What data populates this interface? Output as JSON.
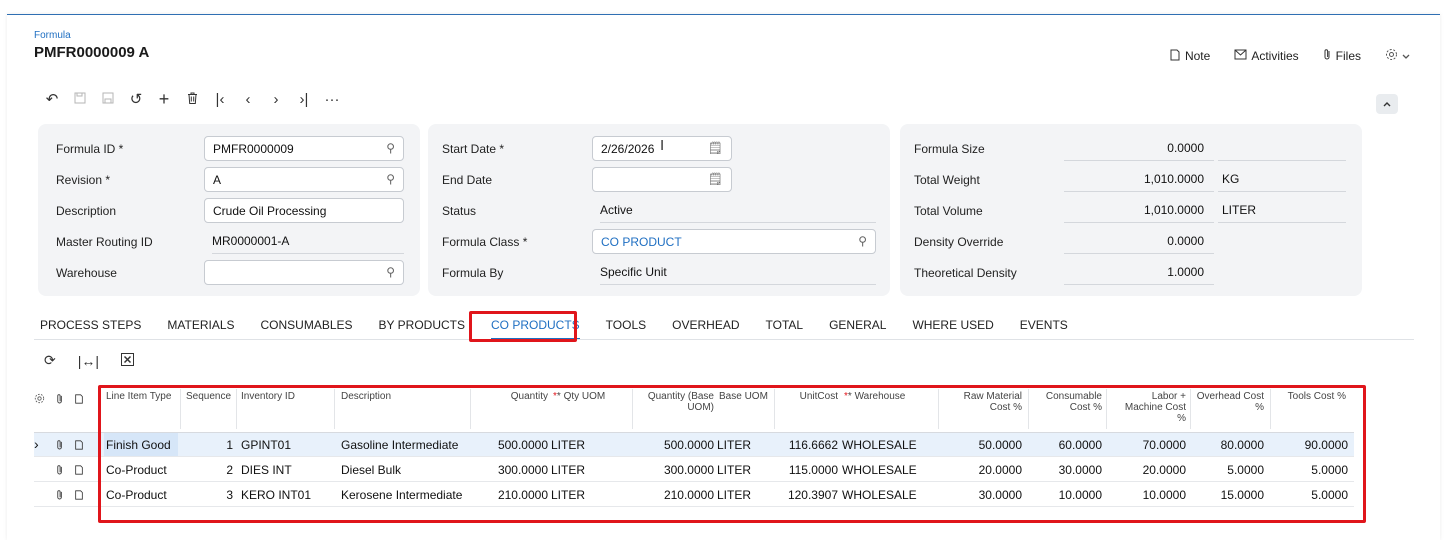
{
  "header": {
    "breadcrumb": "Formula",
    "title": "PMFR0000009 A",
    "actions": {
      "note": "Note",
      "activities": "Activities",
      "files": "Files"
    }
  },
  "toolbar": {
    "icons": [
      "back-icon",
      "save-icon",
      "save-close-icon",
      "cancel-icon",
      "add-icon",
      "delete-icon",
      "first-icon",
      "previous-icon",
      "next-icon",
      "last-icon",
      "more-icon"
    ]
  },
  "summary": {
    "col1": {
      "formula_id": {
        "label": "Formula ID",
        "value": "PMFR0000009"
      },
      "revision": {
        "label": "Revision",
        "value": "A"
      },
      "description": {
        "label": "Description",
        "value": "Crude Oil Processing"
      },
      "master_routing": {
        "label": "Master Routing ID",
        "value": "MR0000001-A"
      },
      "warehouse": {
        "label": "Warehouse",
        "value": ""
      }
    },
    "col2": {
      "start_date": {
        "label": "Start Date",
        "value": "2/26/2026"
      },
      "end_date": {
        "label": "End Date",
        "value": ""
      },
      "status": {
        "label": "Status",
        "value": "Active"
      },
      "formula_class": {
        "label": "Formula Class",
        "value": "CO PRODUCT"
      },
      "formula_by": {
        "label": "Formula By",
        "value": "Specific Unit"
      }
    },
    "col3": {
      "formula_size": {
        "label": "Formula Size",
        "value": "0.0000",
        "unit": ""
      },
      "total_weight": {
        "label": "Total Weight",
        "value": "1,010.0000",
        "unit": "KG"
      },
      "total_volume": {
        "label": "Total Volume",
        "value": "1,010.0000",
        "unit": "LITER"
      },
      "density_override": {
        "label": "Density Override",
        "value": "0.0000"
      },
      "theoretical_density": {
        "label": "Theoretical Density",
        "value": "1.0000"
      }
    }
  },
  "tabs": [
    "PROCESS STEPS",
    "MATERIALS",
    "CONSUMABLES",
    "BY PRODUCTS",
    "CO PRODUCTS",
    "TOOLS",
    "OVERHEAD",
    "TOTAL",
    "GENERAL",
    "WHERE USED",
    "EVENTS"
  ],
  "active_tab": "CO PRODUCTS",
  "grid": {
    "columns": {
      "line_item_type": "Line Item Type",
      "sequence": "Sequence",
      "inventory_id": "Inventory ID",
      "description": "Description",
      "quantity": "Quantity",
      "qty_uom": "* Qty UOM",
      "qty_base_1": "Quantity (Base",
      "qty_base_2": "UOM)",
      "base_uom": "Base UOM",
      "unit_cost": "UnitCost",
      "warehouse": "* Warehouse",
      "raw_1": "Raw Material",
      "raw_2": "Cost %",
      "cons_1": "Consumable",
      "cons_2": "Cost %",
      "labor_1": "Labor +",
      "labor_2": "Machine Cost",
      "labor_3": "%",
      "overhead_1": "Overhead Cost",
      "overhead_2": "%",
      "tools": "Tools Cost %"
    },
    "rows": [
      {
        "type": "Finish Good",
        "seq": "1",
        "inv": "GPINT01",
        "desc": "Gasoline Intermediate",
        "qty": "500.0000",
        "uom": "LITER",
        "bqty": "500.0000",
        "buom": "LITER",
        "cost": "116.6662",
        "wh": "WHOLESALE",
        "raw": "50.0000",
        "cons": "60.0000",
        "labor": "70.0000",
        "oh": "80.0000",
        "tools": "90.0000"
      },
      {
        "type": "Co-Product",
        "seq": "2",
        "inv": "DIES INT",
        "desc": "Diesel Bulk",
        "qty": "300.0000",
        "uom": "LITER",
        "bqty": "300.0000",
        "buom": "LITER",
        "cost": "115.0000",
        "wh": "WHOLESALE",
        "raw": "20.0000",
        "cons": "30.0000",
        "labor": "20.0000",
        "oh": "5.0000",
        "tools": "5.0000"
      },
      {
        "type": "Co-Product",
        "seq": "3",
        "inv": "KERO INT01",
        "desc": "Kerosene Intermediate",
        "qty": "210.0000",
        "uom": "LITER",
        "bqty": "210.0000",
        "buom": "LITER",
        "cost": "120.3907",
        "wh": "WHOLESALE",
        "raw": "30.0000",
        "cons": "10.0000",
        "labor": "10.0000",
        "oh": "15.0000",
        "tools": "5.0000"
      }
    ]
  },
  "colors": {
    "accent": "#1f6fc2",
    "highlight": "#e0151b",
    "panel": "#f3f4f6",
    "selected_row": "#e8f1fb"
  }
}
